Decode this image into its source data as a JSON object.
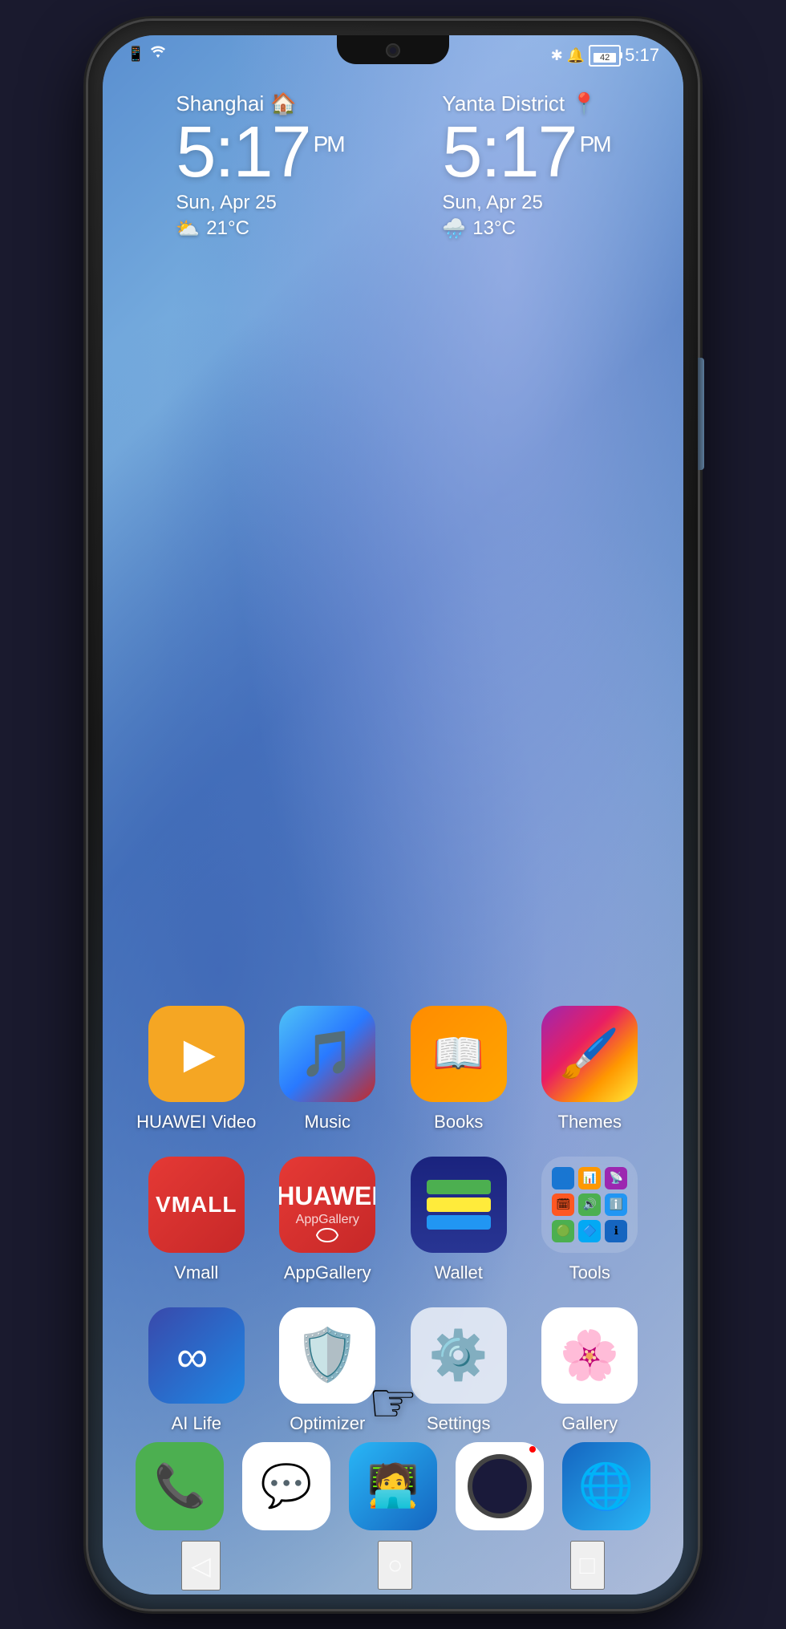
{
  "phone": {
    "status_bar": {
      "time": "5:17",
      "battery": "42",
      "icons_left": [
        "sim-icon",
        "wifi-icon"
      ],
      "icons_right": [
        "bluetooth-icon",
        "notification-icon",
        "battery-icon",
        "time-icon"
      ]
    },
    "clock_widgets": [
      {
        "city": "Shanghai",
        "city_icon": "🏠",
        "time": "5:17",
        "ampm": "PM",
        "date": "Sun, Apr 25",
        "weather_icon": "⛅",
        "temp": "21°C"
      },
      {
        "city": "Yanta District",
        "city_icon": "📍",
        "time": "5:17",
        "ampm": "PM",
        "date": "Sun, Apr 25",
        "weather_icon": "🌧️",
        "temp": "13°C"
      }
    ],
    "apps": [
      {
        "id": "huawei-video",
        "label": "HUAWEI Video",
        "icon_type": "huawei-video"
      },
      {
        "id": "music",
        "label": "Music",
        "icon_type": "music"
      },
      {
        "id": "books",
        "label": "Books",
        "icon_type": "books"
      },
      {
        "id": "themes",
        "label": "Themes",
        "icon_type": "themes"
      },
      {
        "id": "vmall",
        "label": "Vmall",
        "icon_type": "vmall"
      },
      {
        "id": "appgallery",
        "label": "AppGallery",
        "icon_type": "appgallery"
      },
      {
        "id": "wallet",
        "label": "Wallet",
        "icon_type": "wallet"
      },
      {
        "id": "tools",
        "label": "Tools",
        "icon_type": "tools"
      },
      {
        "id": "ai-life",
        "label": "AI Life",
        "icon_type": "ai-life"
      },
      {
        "id": "optimizer",
        "label": "Optimizer",
        "icon_type": "optimizer"
      },
      {
        "id": "settings",
        "label": "Settings",
        "icon_type": "settings"
      },
      {
        "id": "gallery",
        "label": "Gallery",
        "icon_type": "gallery"
      }
    ],
    "dock": [
      {
        "id": "phone",
        "icon_type": "phone"
      },
      {
        "id": "messages",
        "icon_type": "messages"
      },
      {
        "id": "support",
        "icon_type": "support"
      },
      {
        "id": "camera",
        "icon_type": "camera"
      },
      {
        "id": "browser",
        "icon_type": "browser"
      }
    ],
    "page_dots": [
      {
        "active": false
      },
      {
        "active": true
      },
      {
        "active": false
      }
    ],
    "nav": {
      "back": "◁",
      "home": "○",
      "recent": "□"
    }
  }
}
